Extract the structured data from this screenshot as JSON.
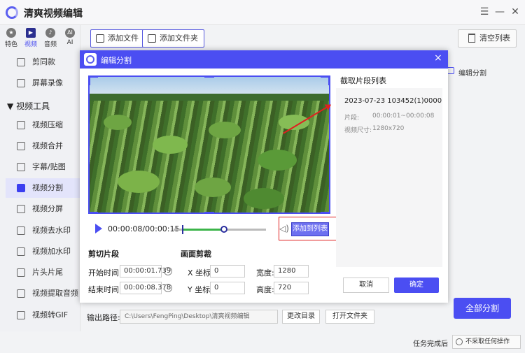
{
  "app": {
    "title": "清爽视频编辑"
  },
  "categories": [
    {
      "label": "特色",
      "icon": "star-icon"
    },
    {
      "label": "视频",
      "icon": "video-icon"
    },
    {
      "label": "音频",
      "icon": "music-icon"
    },
    {
      "label": "AI",
      "icon": "ai-icon"
    }
  ],
  "sidebar": {
    "top_items": [
      "剪同款",
      "屏幕录像"
    ],
    "section_label": "视频工具",
    "section_arrow": "▼",
    "tools": [
      "视频压缩",
      "视频合并",
      "字幕/贴图",
      "视频分割",
      "视频分屏",
      "视频去水印",
      "视频加水印",
      "片头片尾",
      "视频提取音频",
      "视频转GIF"
    ],
    "active_tool": "视频分割"
  },
  "toolbar": {
    "add_file": "添加文件",
    "add_folder": "添加文件夹",
    "clear_list": "清空列表"
  },
  "right_panel": {
    "label": "编辑分割"
  },
  "output": {
    "label": "输出路径:",
    "path": "C:\\Users\\FengPing\\Desktop\\清爽视频编辑",
    "change_dir": "更改目录",
    "open_folder": "打开文件夹"
  },
  "all_split": "全部分割",
  "status": {
    "on_complete_label": "任务完成后",
    "on_complete_value": "不采取任何操作"
  },
  "dialog": {
    "title": "编辑分割",
    "close": "×",
    "player": {
      "time": "00:00:08/00:00:15",
      "progress": 0.53
    },
    "add_to_list": "添加到列表",
    "clip_section": {
      "title": "剪切片段",
      "start_label": "开始时间:",
      "start_value": "00:00:01.739",
      "end_label": "结束时间:",
      "end_value": "00:00:08.378"
    },
    "crop_section": {
      "title": "画面剪裁",
      "x_label": "X 坐标:",
      "x_value": "0",
      "y_label": "Y 坐标:",
      "y_value": "0",
      "w_label": "宽度:",
      "w_value": "1280",
      "h_label": "高度:",
      "h_value": "720"
    },
    "list": {
      "title": "截取片段列表",
      "item": {
        "name": "2023-07-23 103452(1)0000.",
        "segment_label": "片段:",
        "segment_value": "00:00:01~00:00:08",
        "size_label": "视频尺寸:",
        "size_value": "1280x720"
      }
    },
    "cancel": "取消",
    "confirm": "确定"
  }
}
